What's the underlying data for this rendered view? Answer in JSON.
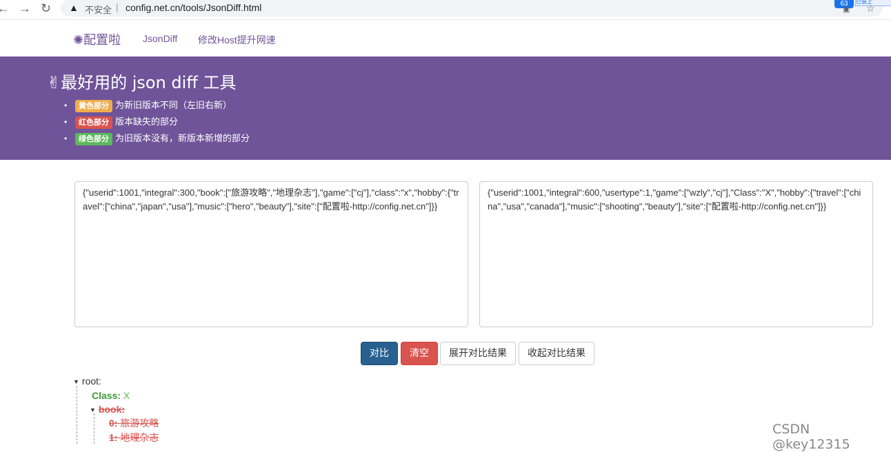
{
  "browser": {
    "back_glyph": "←",
    "forward_glyph": "→",
    "reload_glyph": "↻",
    "warning_glyph": "▲",
    "security_text": "不安全",
    "separator": "|",
    "url": "config.net.cn/tools/JsonDiff.html",
    "extension_badge": "63",
    "extension_strip_text": "已装上",
    "qr_glyph": "▣",
    "star_glyph": "☆"
  },
  "navbar": {
    "brand": "✺配置啦",
    "links": [
      "JsonDiff",
      "修改Host提升网速"
    ]
  },
  "hero": {
    "title": "✌最好用的 json diff 工具",
    "legend": [
      {
        "badge": "黄色部分",
        "text": "为新旧版本不同（左旧右新）"
      },
      {
        "badge": "红色部分",
        "text": "版本缺失的部分"
      },
      {
        "badge": "绿色部分",
        "text": "为旧版本没有，新版本新增的部分"
      }
    ]
  },
  "inputs": {
    "left_value": "{\"userid\":1001,\"integral\":300,\"book\":[\"旅游攻略\",\"地理杂志\"],\"game\":[\"cj\"],\"class\":\"x\",\"hobby\":{\"travel\":[\"china\",\"japan\",\"usa\"],\"music\":[\"hero\",\"beauty\"],\"site\":[\"配置啦-http://config.net.cn\"]}}",
    "right_value": "{\"userid\":1001,\"integral\":600,\"usertype\":1,\"game\":[\"wzly\",\"cj\"],\"Class\":\"X\",\"hobby\":{\"travel\":[\"china\",\"usa\",\"canada\"],\"music\":[\"shooting\",\"beauty\"],\"site\":[\"配置啦-http://config.net.cn\"]}}"
  },
  "buttons": {
    "compare": "对比",
    "clear": "清空",
    "expand": "展开对比结果",
    "collapse": "收起对比结果"
  },
  "tree": {
    "root_label": "root:",
    "class_key": "Class:",
    "class_value": "X",
    "book_key": "book:",
    "book_items": [
      {
        "key": "0:",
        "value": "旅游攻略"
      },
      {
        "key": "1:",
        "value": "地理杂志"
      }
    ]
  },
  "watermark": "CSDN @key12315",
  "colors": {
    "purple": "#6f5499",
    "added": "#5cb85c",
    "removed": "#d9534f",
    "changed": "#f0ad4e",
    "primary_button": "#286090"
  },
  "icons": [
    "back-arrow-icon",
    "forward-arrow-icon",
    "reload-icon",
    "warning-icon",
    "qr-code-icon",
    "star-icon",
    "caret-down-icon"
  ]
}
